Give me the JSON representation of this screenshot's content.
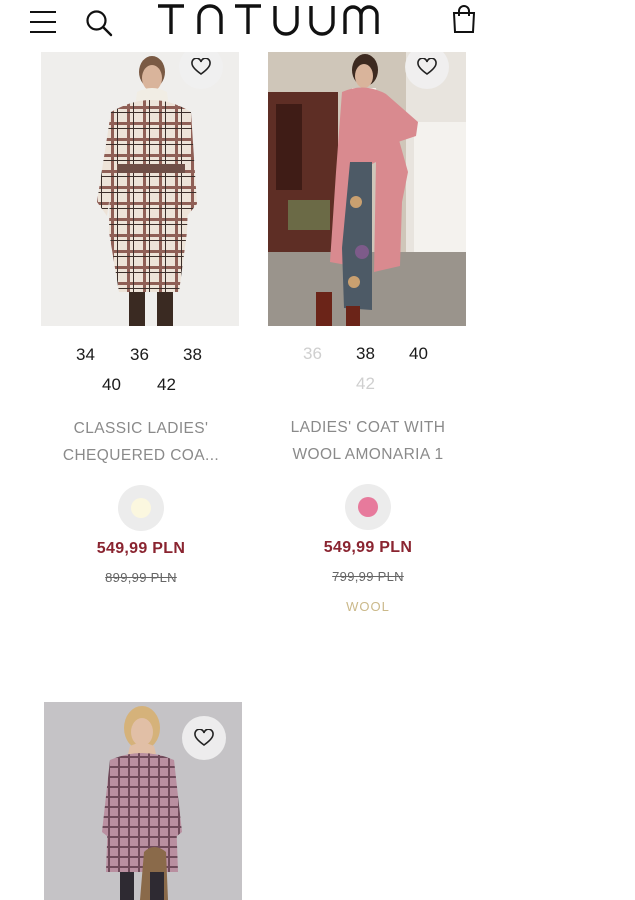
{
  "header": {
    "logo_text": "TATUUM",
    "icons": [
      "menu-icon",
      "search-icon",
      "shopping-bag-icon"
    ]
  },
  "products": [
    {
      "name_line1": "CLASSIC LADIES'",
      "name_line2": "CHEQUERED COA...",
      "sizes": [
        {
          "label": "34",
          "available": true
        },
        {
          "label": "36",
          "available": true
        },
        {
          "label": "38",
          "available": true
        },
        {
          "label": "40",
          "available": true
        },
        {
          "label": "42",
          "available": true
        }
      ],
      "swatch_color": "#fbf7df",
      "price": "549,99 PLN",
      "old_price": "899,99 PLN"
    },
    {
      "name_line1": "LADIES' COAT WITH",
      "name_line2": "WOOL AMONARIA 1",
      "sizes": [
        {
          "label": "36",
          "available": false
        },
        {
          "label": "38",
          "available": true
        },
        {
          "label": "40",
          "available": true
        },
        {
          "label": "42",
          "available": false
        }
      ],
      "swatch_color": "#e77a9c",
      "price": "549,99 PLN",
      "old_price": "799,99 PLN",
      "tag": "WOOL"
    },
    {
      "name_line1": "",
      "name_line2": ""
    }
  ]
}
